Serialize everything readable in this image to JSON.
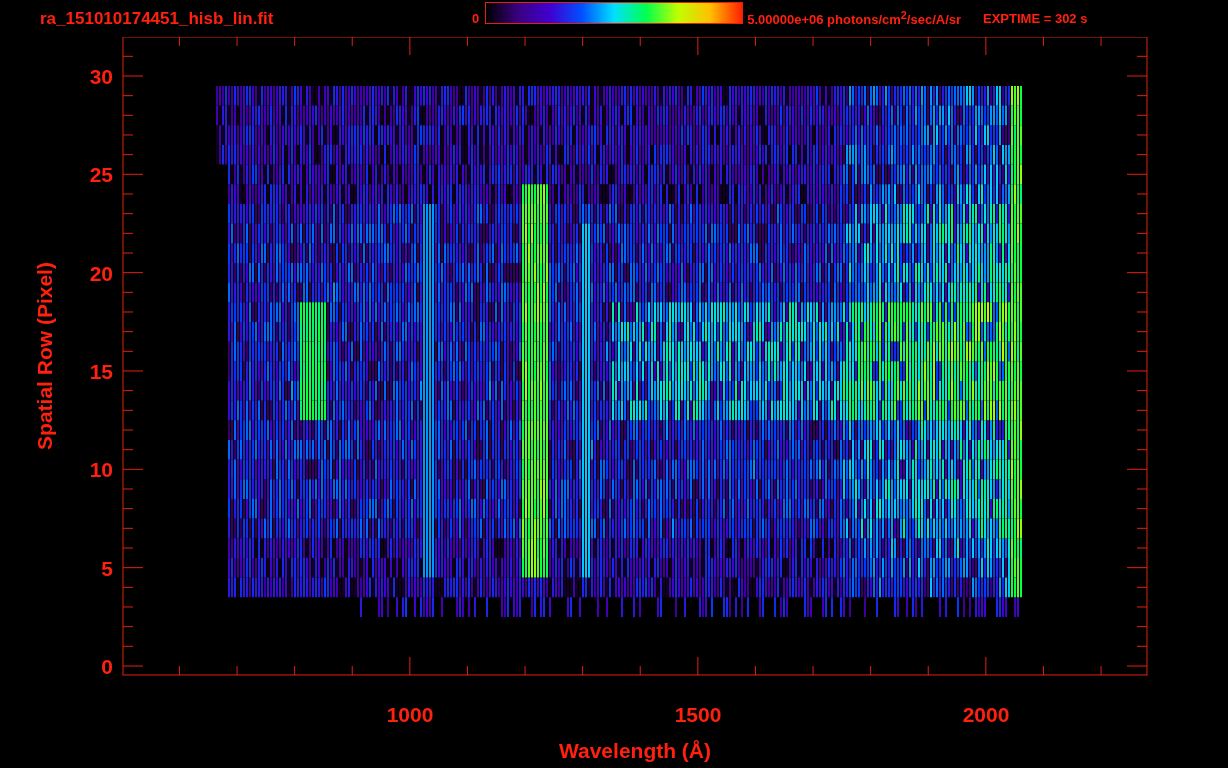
{
  "header": {
    "title": "ra_151010174451_hisb_lin.fit",
    "colorbar": {
      "min_label": "0",
      "max_label": "5.00000e+06 photons/cm$^{2}$/sec/A/sr"
    },
    "exposure": "EXPTIME = 302 s"
  },
  "plot": {
    "xlabel": "Wavelength (Å)",
    "ylabel": "Spatial Row (Pixel)",
    "xticks": [
      "1000",
      "1500",
      "2000"
    ],
    "yticks": [
      "30",
      "25",
      "20",
      "15",
      "10",
      "5",
      "0"
    ]
  }
}
